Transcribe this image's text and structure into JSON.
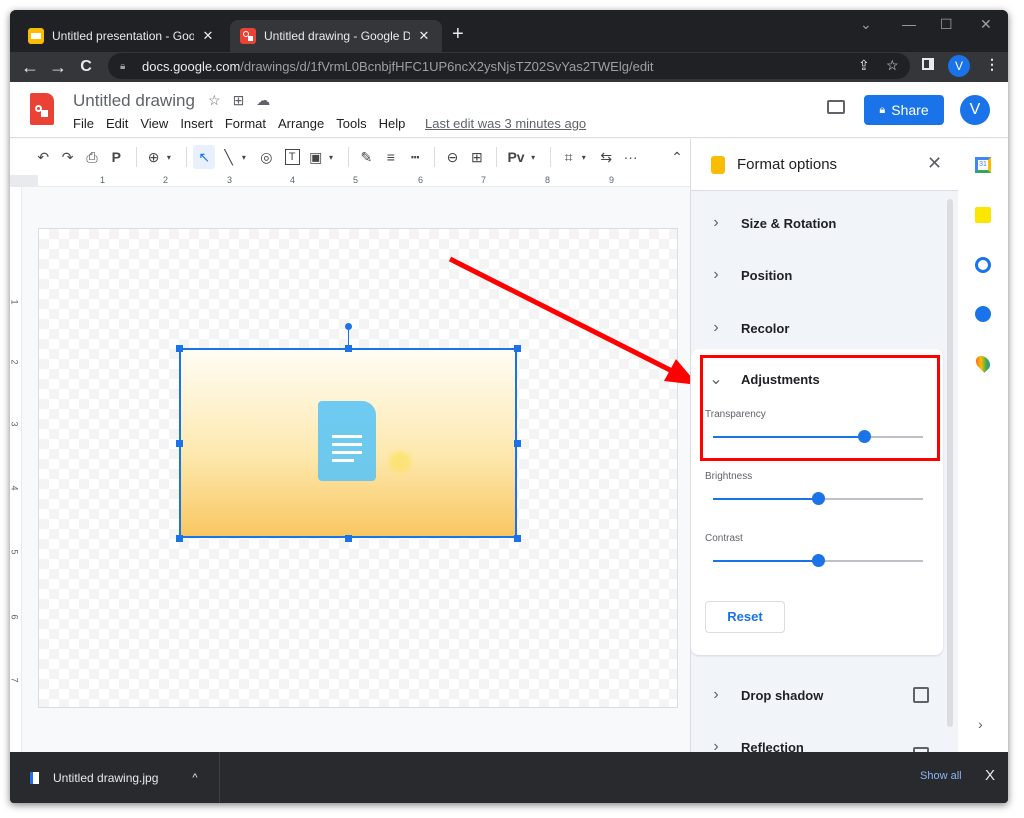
{
  "browser": {
    "tabs": [
      {
        "title": "Untitled presentation - Google Sl",
        "favicon": "google-slides-icon",
        "active": false
      },
      {
        "title": "Untitled drawing - Google Drawi",
        "favicon": "google-drawings-icon",
        "active": true
      }
    ],
    "new_tab": "+",
    "window_controls": {
      "tabsearch": "⌄",
      "minimize": "—",
      "maximize": "☐",
      "close": "✕"
    },
    "nav": {
      "back": "←",
      "forward": "→",
      "reload": "C"
    },
    "url": {
      "host": "docs.google.com",
      "path": "/drawings/d/1fVrmL0BcnbjfHFC1UP6ncX2ysNjsTZ02SvYas2TWElg/edit"
    },
    "profile_initial": "V"
  },
  "app": {
    "doc_title": "Untitled drawing",
    "menus": [
      "File",
      "Edit",
      "View",
      "Insert",
      "Format",
      "Arrange",
      "Tools",
      "Help"
    ],
    "last_edit": "Last edit was 3 minutes ago",
    "share_label": "Share",
    "avatar_initial": "V",
    "brand_color": "#1a73e8"
  },
  "toolbar": {
    "buttons": [
      "undo",
      "redo",
      "print",
      "paint-format",
      "zoom",
      "select",
      "line",
      "shape",
      "text-box",
      "image",
      "border-color",
      "border-weight",
      "border-dash",
      "link",
      "comment",
      "alt-text",
      "crop",
      "replace-image",
      "more"
    ],
    "glyphs": {
      "undo": "↶",
      "redo": "↷",
      "print": "⎙",
      "paint": "🖌",
      "zoom": "⊕",
      "select": "↖",
      "line": "╲",
      "shape": "◎",
      "textbox": "T",
      "image": "▣",
      "pen": "✎",
      "weight": "≡",
      "dash": "┅",
      "link": "⊖",
      "comment": "⊞",
      "alt": "Pv",
      "crop": "⌗",
      "replace": "⇆",
      "more": "···",
      "collapse": "⌃",
      "dropdown": "▾"
    }
  },
  "ruler": {
    "horizontal": [
      "1",
      "2",
      "3",
      "4",
      "5",
      "6",
      "7",
      "8",
      "9"
    ],
    "vertical": [
      "1",
      "2",
      "3",
      "4",
      "5",
      "6",
      "7"
    ]
  },
  "format_panel": {
    "title": "Format options",
    "close": "✕",
    "sections": [
      {
        "label": "Size & Rotation",
        "expanded": false
      },
      {
        "label": "Position",
        "expanded": false
      },
      {
        "label": "Recolor",
        "expanded": false
      },
      {
        "label": "Adjustments",
        "expanded": true
      },
      {
        "label": "Drop shadow",
        "expanded": false,
        "checkbox": false
      },
      {
        "label": "Reflection",
        "expanded": false,
        "checkbox": false
      }
    ],
    "adjustments": {
      "transparency": {
        "label": "Transparency",
        "value_percent": 72
      },
      "brightness": {
        "label": "Brightness",
        "value_percent": 50
      },
      "contrast": {
        "label": "Contrast",
        "value_percent": 50
      },
      "reset_label": "Reset"
    },
    "chevron_right": "›",
    "chevron_down": "⌄"
  },
  "addons_rail": {
    "items": [
      "google-calendar-icon",
      "google-keep-icon",
      "google-tasks-icon",
      "google-contacts-icon",
      "google-maps-icon"
    ],
    "expand": "›"
  },
  "downloads": {
    "file_name": "Untitled drawing.jpg",
    "caret": "^",
    "show_all": "Show all",
    "close": "X"
  },
  "annotation": {
    "color": "#ff0000",
    "highlight_target": "Adjustments"
  }
}
